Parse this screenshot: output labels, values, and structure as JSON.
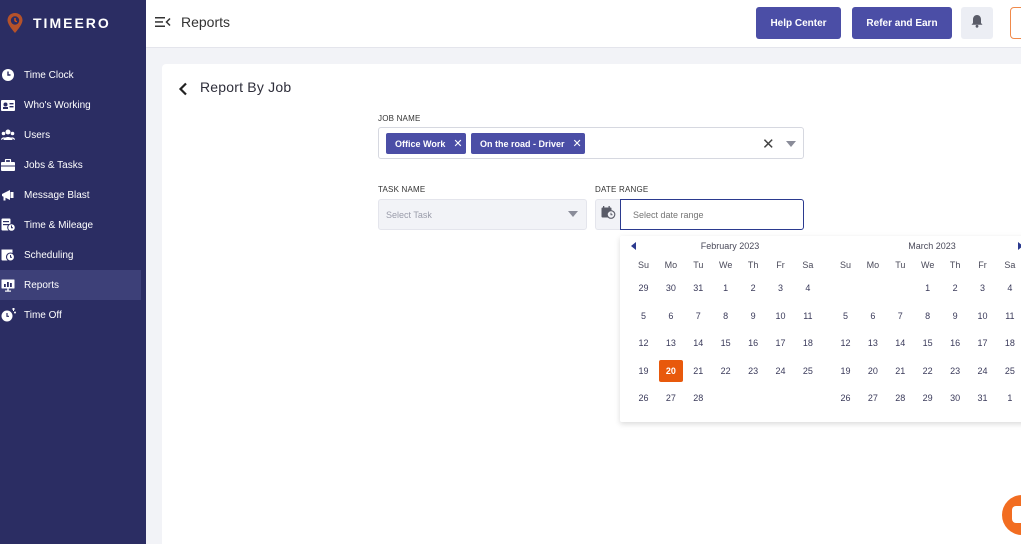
{
  "brand": {
    "name": "TIMEERO",
    "accent": "#e8590c",
    "sidebar_bg": "#2b2d63",
    "primary": "#4b4ea6"
  },
  "sidebar": {
    "items": [
      {
        "label": "Time Clock",
        "icon": "clock-icon",
        "active": false
      },
      {
        "label": "Who's Working",
        "icon": "id-card-icon",
        "active": false
      },
      {
        "label": "Users",
        "icon": "users-icon",
        "active": false
      },
      {
        "label": "Jobs & Tasks",
        "icon": "briefcase-icon",
        "active": false
      },
      {
        "label": "Message Blast",
        "icon": "megaphone-icon",
        "active": false
      },
      {
        "label": "Time & Mileage",
        "icon": "timesheet-icon",
        "active": false
      },
      {
        "label": "Scheduling",
        "icon": "calendar-clock-icon",
        "active": false
      },
      {
        "label": "Reports",
        "icon": "reports-icon",
        "active": true
      },
      {
        "label": "Time Off",
        "icon": "time-off-icon",
        "active": false
      }
    ]
  },
  "header": {
    "title": "Reports",
    "help_label": "Help Center",
    "refer_label": "Refer and Earn"
  },
  "report": {
    "title": "Report By Job",
    "job_name_label": "JOB NAME",
    "job_chips": [
      "Office Work",
      "On the road - Driver"
    ],
    "task_name_label": "TASK NAME",
    "task_placeholder": "Select Task",
    "date_range_label": "DATE RANGE",
    "date_placeholder": "Select date range"
  },
  "calendar": {
    "weekdays": [
      "Su",
      "Mo",
      "Tu",
      "We",
      "Th",
      "Fr",
      "Sa"
    ],
    "months": [
      {
        "title": "February 2023",
        "weeks": [
          [
            "29",
            "30",
            "31",
            "1",
            "2",
            "3",
            "4"
          ],
          [
            "5",
            "6",
            "7",
            "8",
            "9",
            "10",
            "11"
          ],
          [
            "12",
            "13",
            "14",
            "15",
            "16",
            "17",
            "18"
          ],
          [
            "19",
            "20",
            "21",
            "22",
            "23",
            "24",
            "25"
          ],
          [
            "26",
            "27",
            "28",
            "",
            "",
            "",
            ""
          ]
        ],
        "selected": "20"
      },
      {
        "title": "March 2023",
        "weeks": [
          [
            "",
            "",
            "",
            "1",
            "2",
            "3",
            "4"
          ],
          [
            "5",
            "6",
            "7",
            "8",
            "9",
            "10",
            "11"
          ],
          [
            "12",
            "13",
            "14",
            "15",
            "16",
            "17",
            "18"
          ],
          [
            "19",
            "20",
            "21",
            "22",
            "23",
            "24",
            "25"
          ],
          [
            "26",
            "27",
            "28",
            "29",
            "30",
            "31",
            "1"
          ]
        ],
        "selected": ""
      }
    ]
  }
}
